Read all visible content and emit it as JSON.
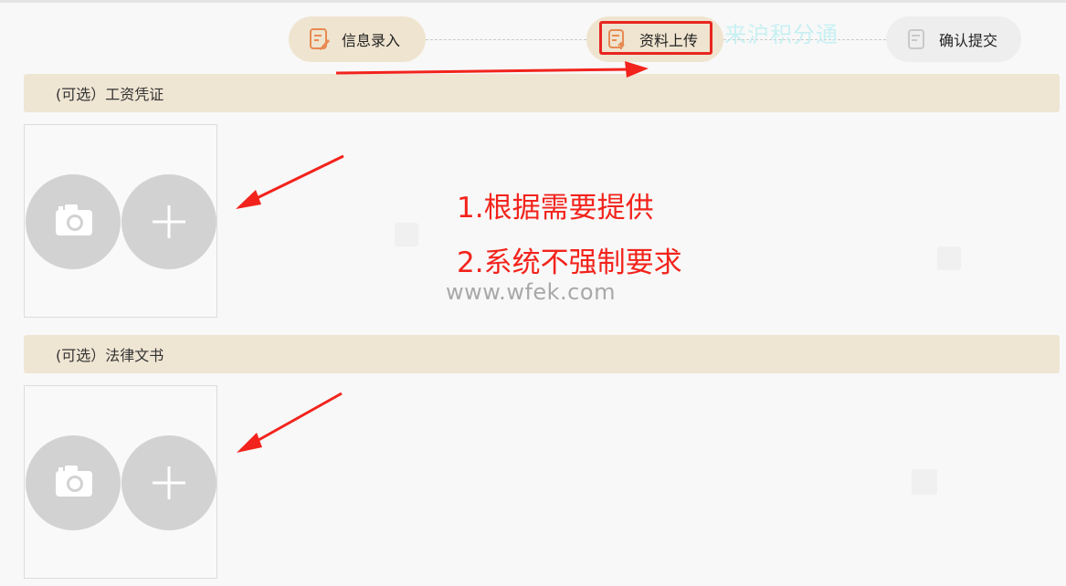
{
  "steps": [
    {
      "label": "信息录入",
      "icon": "form-edit-icon",
      "state": "done"
    },
    {
      "label": "资料上传",
      "icon": "document-upload-icon",
      "state": "active"
    },
    {
      "label": "确认提交",
      "icon": "document-check-icon",
      "state": "pending"
    }
  ],
  "watermark_text": "来沪积分通",
  "sections": [
    {
      "title": "(可选）工资凭证"
    },
    {
      "title": "(可选）法律文书"
    }
  ],
  "annotations": {
    "line1": "1.根据需要提供",
    "line2": "2.系统不强制要求",
    "color": "#f2231c"
  },
  "site_watermark": "www.wfek.com",
  "colors": {
    "step_active_bg": "#efe4cf",
    "section_header_bg": "#efe5d3",
    "step_icon": "#e88a53"
  }
}
